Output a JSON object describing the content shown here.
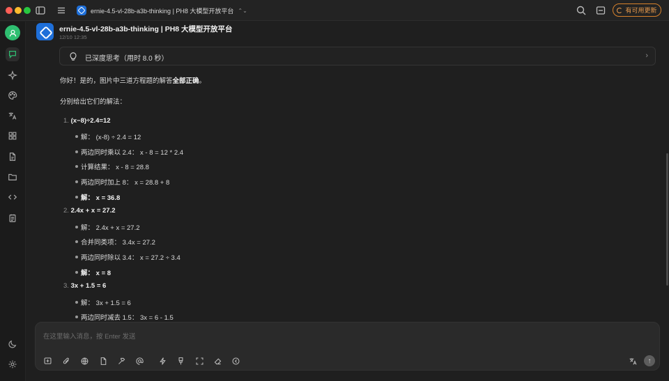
{
  "window": {
    "model_chip_label": "ernie-4.5-vl-28b-a3b-thinking | PH8 大模型开放平台",
    "update_button_label": "有可用更新"
  },
  "sidebar": {
    "items": [
      {
        "name": "chat-icon"
      },
      {
        "name": "sparkle-icon"
      },
      {
        "name": "palette-icon"
      },
      {
        "name": "translate-icon"
      },
      {
        "name": "apps-grid-icon"
      },
      {
        "name": "document-icon"
      },
      {
        "name": "folder-icon"
      },
      {
        "name": "code-icon"
      },
      {
        "name": "notepad-icon"
      },
      {
        "name": "moon-icon"
      },
      {
        "name": "settings-icon"
      }
    ]
  },
  "message": {
    "sender": "ernie-4.5-vl-28b-a3b-thinking | PH8 大模型开放平台",
    "timestamp": "12/10 12:35",
    "thinking_label": "已深度思考（用时 8.0 秒）",
    "intro_prefix": "你好！是的，图片中三道方程题的解答",
    "intro_bold": "全部正确",
    "intro_suffix": "。",
    "subtitle": "分别给出它们的解法：",
    "problems": [
      {
        "number": "1.",
        "title": "(x−8)÷2.4=12",
        "steps": [
          {
            "label": "解：",
            "value": "(x-8) ÷ 2.4 = 12",
            "bold": false
          },
          {
            "label": "两边同时乘以 2.4：",
            "value": "x - 8 = 12 * 2.4",
            "bold": false
          },
          {
            "label": "计算结果：",
            "value": "x - 8 = 28.8",
            "bold": false
          },
          {
            "label": "两边同时加上 8：",
            "value": "x = 28.8 + 8",
            "bold": false
          },
          {
            "label": "解：",
            "value": "x = 36.8",
            "bold": true
          }
        ]
      },
      {
        "number": "2.",
        "title": "2.4x + x = 27.2",
        "steps": [
          {
            "label": "解：",
            "value": "2.4x + x = 27.2",
            "bold": false
          },
          {
            "label": "合并同类项：",
            "value": "3.4x = 27.2",
            "bold": false
          },
          {
            "label": "两边同时除以 3.4：",
            "value": "x = 27.2 ÷ 3.4",
            "bold": false
          },
          {
            "label": "解：",
            "value": "x = 8",
            "bold": true
          }
        ]
      },
      {
        "number": "3.",
        "title": "3x + 1.5 = 6",
        "steps": [
          {
            "label": "解：",
            "value": "3x + 1.5 = 6",
            "bold": false
          },
          {
            "label": "两边同时减去 1.5：",
            "value": "3x = 6 - 1.5",
            "bold": false
          }
        ]
      }
    ]
  },
  "composer": {
    "placeholder": "在这里输入消息，按 Enter 发送",
    "tools": [
      "new-topic-icon",
      "attach-icon",
      "globe-icon",
      "file-icon",
      "hammer-icon",
      "mention-icon",
      "lightning-icon",
      "brush-icon",
      "fullscreen-icon",
      "eraser-icon",
      "stop-circle-icon",
      "translate-icon",
      "send-icon"
    ]
  }
}
